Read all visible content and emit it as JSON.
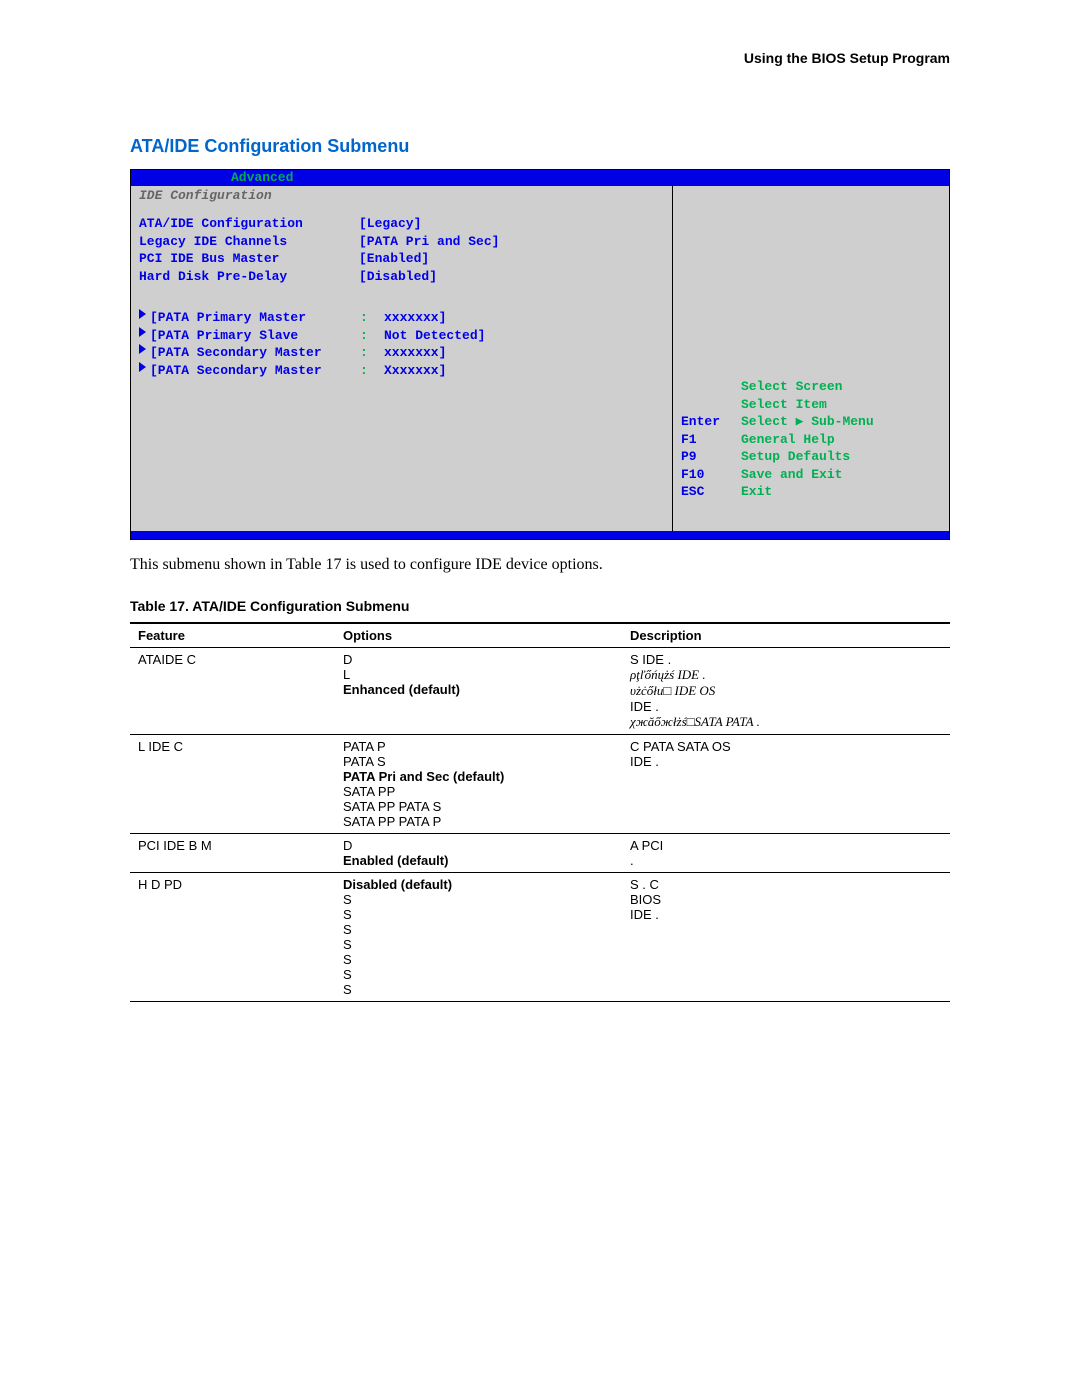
{
  "header": {
    "right": "Using the BIOS Setup Program"
  },
  "section_title": "ATA/IDE Configuration Submenu",
  "bios": {
    "top_label": "Advanced",
    "subtitle": "IDE Configuration",
    "settings": [
      {
        "label": "ATA/IDE Configuration",
        "value": "[Legacy]"
      },
      {
        "label": "Legacy IDE Channels",
        "value": "[PATA Pri and Sec]"
      },
      {
        "label": "PCI IDE Bus Master",
        "value": "[Enabled]"
      },
      {
        "label": "Hard Disk Pre-Delay",
        "value": "[Disabled]"
      }
    ],
    "devices": [
      {
        "label": "[PATA Primary Master",
        "sep": " :",
        "value": "xxxxxxx]"
      },
      {
        "label": "[PATA Primary Slave",
        "sep": " :",
        "value": "Not Detected]"
      },
      {
        "label": "[PATA Secondary Master",
        "sep": " :",
        "value": "xxxxxxx]"
      },
      {
        "label": "[PATA Secondary Master",
        "sep": " :",
        "value": "Xxxxxxx]"
      }
    ],
    "help": [
      {
        "key": "",
        "action": "Select Screen"
      },
      {
        "key": "",
        "action": "Select Item"
      },
      {
        "key": "Enter",
        "action": "Select ▶ Sub-Menu"
      },
      {
        "key": "F1",
        "action": "General Help"
      },
      {
        "key": "P9",
        "action": "Setup Defaults"
      },
      {
        "key": "F10",
        "action": "Save and Exit"
      },
      {
        "key": "ESC",
        "action": "Exit"
      }
    ]
  },
  "intro_text": "This submenu shown in Table 17 is used to configure IDE device options.",
  "table": {
    "caption": "Table 17.   ATA/IDE Configuration Submenu",
    "headers": {
      "c1": "Feature",
      "c2": "Options",
      "c3": "Description"
    },
    "rows": [
      {
        "feature": "ATAIDE C",
        "options": [
          {
            "text": "D"
          },
          {
            "text": "L"
          },
          {
            "text": "Enhanced (default)",
            "bold": true
          }
        ],
        "description": [
          {
            "text": "S  IDE ."
          },
          {
            "text": "ρţľőńųżś     IDE .",
            "italic": true
          },
          {
            "text": "υżċőłu□    IDE  OS",
            "italic": true
          },
          {
            "text": " IDE ."
          },
          {
            "text": "χжăőжłżś□SATA  PATA .",
            "italic": true
          }
        ]
      },
      {
        "feature": "L IDE C",
        "options": [
          {
            "text": "PATA P"
          },
          {
            "text": "PATA S"
          },
          {
            "text": "PATA Pri and Sec (default)",
            "bold": true
          },
          {
            "text": "SATA PP"
          },
          {
            "text": "SATA PP PATA S"
          },
          {
            "text": "SATA PP PATA P"
          }
        ],
        "description": [
          {
            "text": "C PATA  SATA  OS"
          },
          {
            "text": "  IDE ."
          }
        ]
      },
      {
        "feature": "PCI IDE B M",
        "options": [
          {
            "text": "D"
          },
          {
            "text": "Enabled (default)",
            "bold": true
          }
        ],
        "description": [
          {
            "text": "A  PCI"
          },
          {
            "text": "."
          }
        ]
      },
      {
        "feature": "H D PD",
        "options": [
          {
            "text": "Disabled (default)",
            "bold": true
          },
          {
            "text": " S"
          },
          {
            "text": " S"
          },
          {
            "text": " S"
          },
          {
            "text": " S"
          },
          {
            "text": " S"
          },
          {
            "text": " S"
          },
          {
            "text": " S"
          }
        ],
        "description": [
          {
            "text": "S    .  C"
          },
          {
            "text": "  BIOS"
          },
          {
            "text": " IDE   ."
          }
        ]
      }
    ]
  }
}
